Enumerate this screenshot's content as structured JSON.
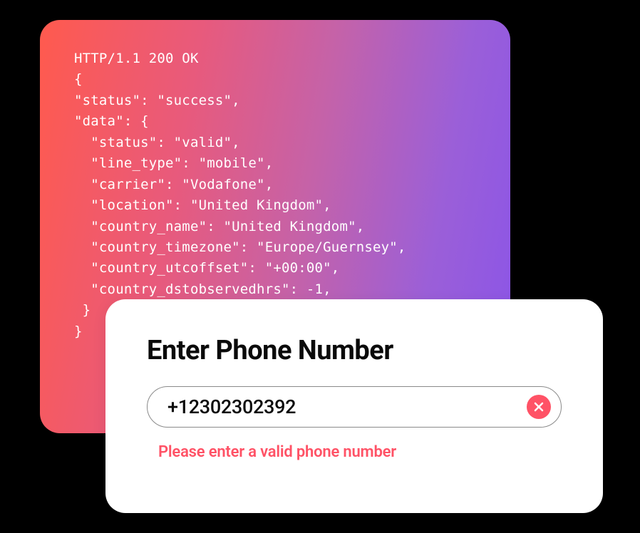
{
  "code": {
    "lines": [
      "HTTP/1.1 200 OK",
      "{",
      "\"status\": \"success\",",
      "\"data\": {",
      "  \"status\": \"valid\",",
      "  \"line_type\": \"mobile\",",
      "  \"carrier\": \"Vodafone\",",
      "  \"location\": \"United Kingdom\",",
      "  \"country_name\": \"United Kingdom\",",
      "  \"country_timezone\": \"Europe/Guernsey\",",
      "  \"country_utcoffset\": \"+00:00\",",
      "  \"country_dstobservedhrs\": -1,",
      "",
      "",
      "",
      "",
      " }",
      "}"
    ]
  },
  "form": {
    "title": "Enter Phone Number",
    "phone_value": "+12302302392",
    "error_message": "Please enter a valid phone number"
  }
}
